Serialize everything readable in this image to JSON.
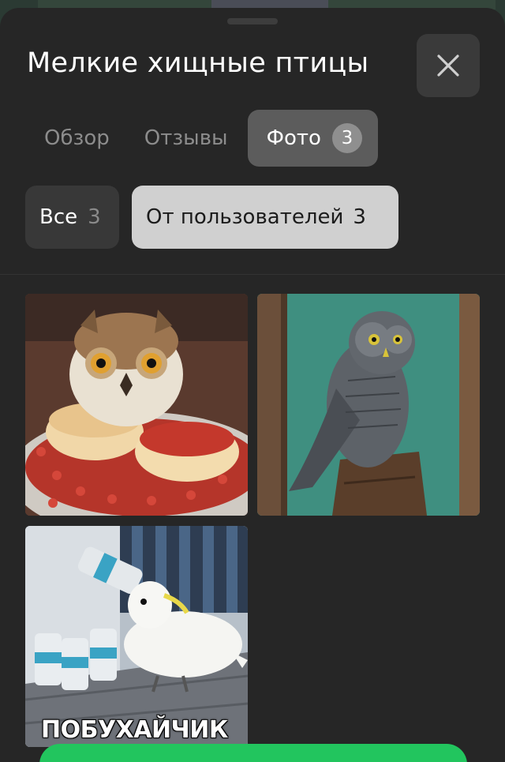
{
  "sheet": {
    "title": "Мелкие хищные птицы",
    "close_icon": "close-icon"
  },
  "tabs": [
    {
      "label": "Обзор",
      "active": false
    },
    {
      "label": "Отзывы",
      "active": false
    },
    {
      "label": "Фото",
      "active": true,
      "count": "3"
    }
  ],
  "filters": [
    {
      "label": "Все",
      "count": "3",
      "selected": false
    },
    {
      "label": "От пользователей",
      "count": "3",
      "selected": true
    }
  ],
  "photos": [
    {
      "subject": "owl on pancakes with red caviar"
    },
    {
      "subject": "grey owl perched on tree stump"
    },
    {
      "subject": "white cockatoo with can",
      "caption": "ПОБУХАЙЧИК"
    }
  ],
  "colors": {
    "sheet_bg": "#262626",
    "accent_green": "#22c55e",
    "active_tab": "#5c5c5c",
    "selected_chip": "#d0d0d0"
  }
}
